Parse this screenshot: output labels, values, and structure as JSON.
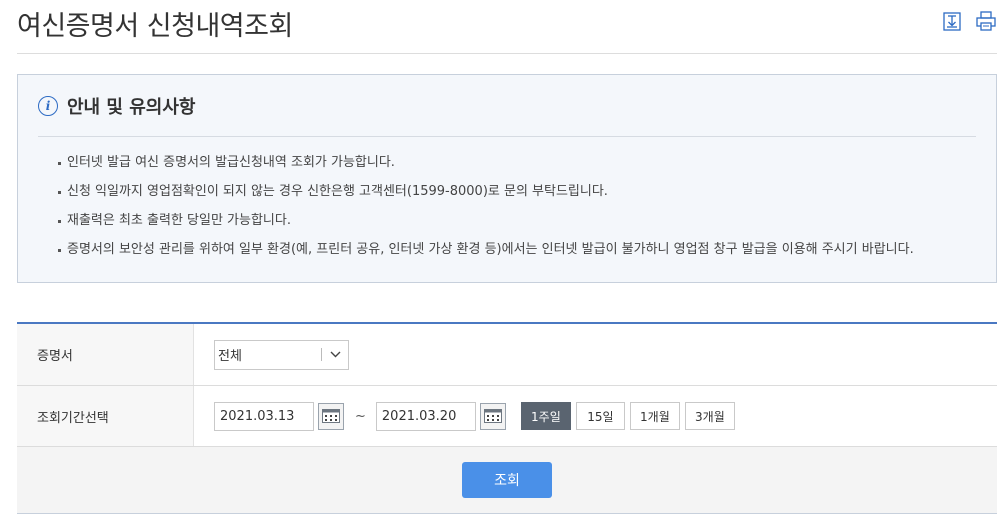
{
  "page": {
    "title": "여신증명서 신청내역조회",
    "download_icon": "download-icon",
    "print_icon": "print-icon"
  },
  "notice": {
    "icon": "info-icon",
    "title": "안내 및 유의사항",
    "items": [
      "인터넷 발급 여신 증명서의 발급신청내역 조회가 가능합니다.",
      "신청 익일까지 영업점확인이 되지 않는 경우 신한은행 고객센터(1599-8000)로 문의 부탁드립니다.",
      "재출력은 최초 출력한 당일만 가능합니다.",
      "증명서의 보안성 관리를 위하여 일부 환경(예, 프린터 공유, 인터넷 가상 환경 등)에서는 인터넷 발급이 불가하니 영업점 창구 발급을 이용해 주시기 바랍니다."
    ]
  },
  "form": {
    "certificate": {
      "label": "증명서",
      "selected": "전체"
    },
    "period": {
      "label": "조회기간선택",
      "start_date": "2021.03.13",
      "separator": "~",
      "end_date": "2021.03.20",
      "buttons": [
        "1주일",
        "15일",
        "1개월",
        "3개월"
      ],
      "active": "1주일"
    },
    "search_label": "조회"
  },
  "colors": {
    "accent": "#4a90e8",
    "table_top_rule": "#4a78c2",
    "active_period": "#5a6470",
    "notice_bg": "#f4f7fb"
  }
}
